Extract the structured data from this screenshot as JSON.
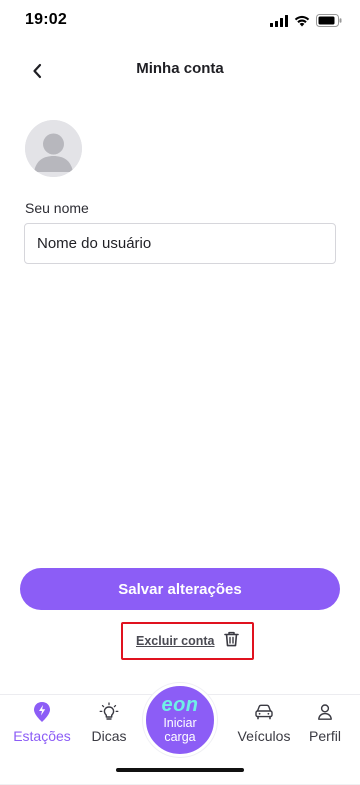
{
  "status_bar": {
    "time": "19:02"
  },
  "header": {
    "title": "Minha conta"
  },
  "profile": {
    "name_label": "Seu nome",
    "name_value": "Nome do usuário"
  },
  "actions": {
    "save_label": "Salvar alterações",
    "delete_label": "Excluir conta"
  },
  "bottom_nav": {
    "items": [
      {
        "label": "Estações",
        "icon": "lightning-pin-icon",
        "active": true
      },
      {
        "label": "Dicas",
        "icon": "lightbulb-icon",
        "active": false
      },
      {
        "label": "Veículos",
        "icon": "car-icon",
        "active": false
      },
      {
        "label": "Perfil",
        "icon": "person-icon",
        "active": false
      }
    ],
    "center": {
      "logo": "eon",
      "label": "Iniciar carga"
    }
  },
  "colors": {
    "accent": "#8c5df6",
    "logo_teal": "#6ff0e6",
    "highlight_red": "#e0121f"
  }
}
